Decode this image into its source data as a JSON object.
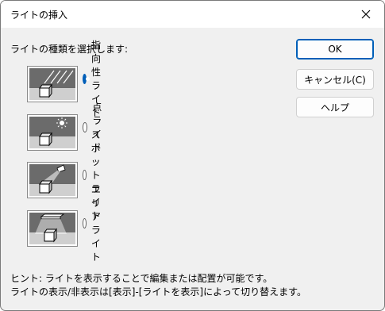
{
  "dialog": {
    "title": "ライトの挿入",
    "prompt": "ライトの種類を選択します:",
    "lights": [
      {
        "label": "指向性ライト",
        "selected": true,
        "icon": "directional-light-icon"
      },
      {
        "label": "点ライト",
        "selected": false,
        "icon": "point-light-icon"
      },
      {
        "label": "スポット ライト",
        "selected": false,
        "icon": "spot-light-icon"
      },
      {
        "label": "エリア ライト",
        "selected": false,
        "icon": "area-light-icon"
      }
    ],
    "buttons": {
      "ok": "OK",
      "cancel": "キャンセル(C)",
      "help": "ヘルプ"
    },
    "hint_line1": "ヒント: ライトを表示することで編集または配置が可能です。",
    "hint_line2": "ライトの表示/非表示は[表示]-[ライトを表示]によって切り替えます。",
    "accent_color": "#005fb8"
  }
}
